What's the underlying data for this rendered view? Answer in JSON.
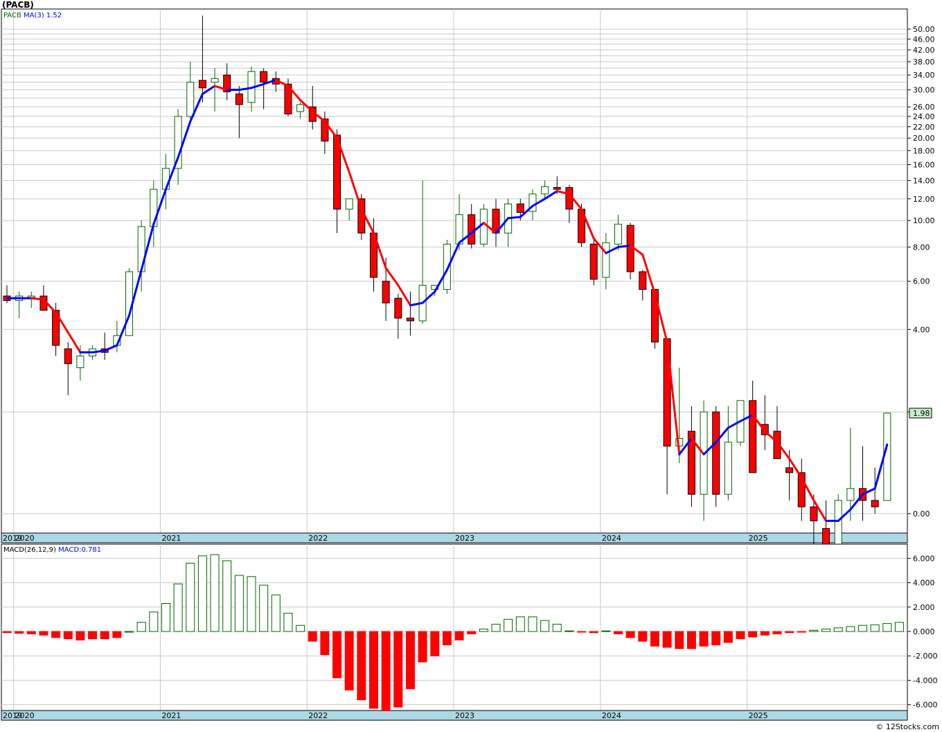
{
  "header": {
    "title": "(PACB)",
    "credit": "© 12Stocks.com"
  },
  "colors": {
    "up": "#006400",
    "down": "#ff0000",
    "ma_up": "#0000ff",
    "ma_down": "#ff0000",
    "grid": "#c8c8c8",
    "axisband": "#add8e6",
    "last_price_bg": "#c8f0c8"
  },
  "chart_data": [
    {
      "type": "candlestick",
      "scale": "log",
      "title": "(PACB)",
      "legend": {
        "symbol": "PACB",
        "ma_label": "MA(3)",
        "ma_value": "1.52"
      },
      "last_price": "1.98",
      "y_ticks": [
        "50.00",
        "46.00",
        "42.00",
        "38.00",
        "34.00",
        "30.00",
        "26.00",
        "24.00",
        "22.00",
        "20.00",
        "18.00",
        "16.00",
        "14.00",
        "12.00",
        "10.00",
        "8.00",
        "6.00",
        "4.00",
        "2.00",
        "0.00"
      ],
      "year_labels": [
        "2019",
        "2020",
        "2021",
        "2022",
        "2023",
        "2024",
        "2025"
      ],
      "x_start": "2019-12",
      "candles": [
        [
          5.3,
          5.8,
          5.0,
          5.1
        ],
        [
          5.1,
          5.5,
          4.4,
          5.3
        ],
        [
          5.3,
          5.5,
          4.8,
          5.3
        ],
        [
          5.3,
          5.8,
          4.8,
          4.7
        ],
        [
          4.7,
          5.0,
          3.2,
          3.5
        ],
        [
          3.4,
          3.6,
          2.3,
          3.0
        ],
        [
          2.9,
          3.5,
          2.6,
          3.2
        ],
        [
          3.2,
          3.5,
          3.1,
          3.4
        ],
        [
          3.4,
          3.9,
          3.1,
          3.3
        ],
        [
          3.5,
          4.3,
          3.3,
          3.8
        ],
        [
          3.8,
          6.7,
          3.8,
          6.5
        ],
        [
          6.5,
          10.0,
          5.5,
          9.5
        ],
        [
          9.5,
          14.0,
          8.0,
          13.0
        ],
        [
          13.0,
          17.5,
          11.0,
          15.5
        ],
        [
          15.5,
          25.5,
          13.5,
          24.0
        ],
        [
          24.0,
          38.0,
          23.5,
          32.0
        ],
        [
          32.5,
          56.0,
          27.0,
          30.5
        ],
        [
          32.0,
          36.0,
          25.0,
          33.0
        ],
        [
          34.0,
          37.5,
          27.5,
          29.5
        ],
        [
          29.0,
          31.0,
          20.0,
          26.5
        ],
        [
          27.0,
          36.5,
          25.0,
          35.0
        ],
        [
          35.0,
          36.0,
          25.5,
          32.0
        ],
        [
          33.0,
          35.0,
          29.5,
          31.5
        ],
        [
          31.5,
          33.0,
          24.0,
          24.5
        ],
        [
          25.0,
          27.0,
          23.5,
          26.5
        ],
        [
          26.0,
          31.0,
          21.5,
          23.0
        ],
        [
          23.5,
          25.0,
          17.5,
          19.5
        ],
        [
          20.5,
          21.5,
          9.0,
          11.0
        ],
        [
          11.0,
          12.0,
          10.0,
          12.0
        ],
        [
          12.0,
          12.5,
          8.5,
          9.0
        ],
        [
          9.0,
          10.2,
          5.5,
          6.2
        ],
        [
          6.0,
          7.3,
          4.3,
          5.0
        ],
        [
          5.2,
          5.4,
          3.7,
          4.4
        ],
        [
          4.4,
          5.5,
          3.8,
          4.3
        ],
        [
          4.3,
          14.0,
          4.2,
          5.8
        ],
        [
          5.6,
          5.8,
          5.3,
          5.8
        ],
        [
          5.6,
          8.5,
          5.4,
          8.2
        ],
        [
          8.2,
          12.5,
          7.8,
          10.5
        ],
        [
          10.5,
          11.5,
          7.9,
          8.2
        ],
        [
          8.2,
          11.5,
          8.0,
          11.0
        ],
        [
          11.0,
          12.0,
          8.0,
          9.0
        ],
        [
          9.0,
          12.0,
          8.0,
          11.5
        ],
        [
          11.5,
          12.0,
          10.0,
          10.7
        ],
        [
          10.8,
          13.0,
          10.0,
          12.5
        ],
        [
          12.5,
          14.0,
          12.0,
          13.3
        ],
        [
          13.2,
          14.5,
          12.5,
          13.0
        ],
        [
          13.2,
          13.5,
          9.8,
          11.0
        ],
        [
          11.0,
          11.5,
          8.0,
          8.3
        ],
        [
          8.2,
          8.5,
          5.8,
          6.1
        ],
        [
          6.2,
          9.0,
          5.6,
          8.3
        ],
        [
          8.2,
          10.5,
          7.8,
          9.7
        ],
        [
          9.6,
          9.8,
          6.1,
          6.5
        ],
        [
          6.5,
          6.6,
          5.1,
          5.6
        ],
        [
          5.6,
          5.5,
          3.4,
          3.6
        ],
        [
          3.7,
          3.7,
          1.0,
          1.5
        ],
        [
          1.5,
          2.9,
          1.3,
          1.6
        ],
        [
          1.7,
          2.1,
          0.9,
          1.0
        ],
        [
          1.0,
          2.2,
          0.8,
          2.0
        ],
        [
          2.0,
          2.1,
          0.9,
          1.0
        ],
        [
          1.0,
          2.1,
          0.95,
          1.55
        ],
        [
          1.55,
          2.2,
          1.5,
          2.2
        ],
        [
          2.2,
          2.6,
          1.2,
          1.2
        ],
        [
          1.8,
          2.3,
          1.45,
          1.65
        ],
        [
          1.7,
          2.1,
          1.4,
          1.35
        ],
        [
          1.25,
          1.45,
          0.95,
          1.2
        ],
        [
          1.2,
          1.35,
          0.8,
          0.9
        ],
        [
          0.9,
          1.0,
          0.6,
          0.8
        ],
        [
          0.75,
          0.95,
          0.55,
          0.55
        ],
        [
          0.6,
          1.0,
          0.55,
          0.95
        ],
        [
          0.95,
          1.75,
          0.8,
          1.05
        ],
        [
          1.05,
          1.5,
          0.8,
          0.95
        ],
        [
          0.95,
          1.25,
          0.85,
          0.9
        ],
        [
          0.95,
          1.98,
          0.95,
          1.98
        ]
      ],
      "ma": [
        5.2,
        5.2,
        5.2,
        5.15,
        4.6,
        3.9,
        3.3,
        3.3,
        3.35,
        3.5,
        4.5,
        6.6,
        9.7,
        13.0,
        17.0,
        23.0,
        29.0,
        31.0,
        30.0,
        30.0,
        30.5,
        31.5,
        32.6,
        31.0,
        27.5,
        25.0,
        23.0,
        20.0,
        15.0,
        11.0,
        9.0,
        6.7,
        5.8,
        4.9,
        5.0,
        5.5,
        6.6,
        8.3,
        9.0,
        9.8,
        9.0,
        10.2,
        10.3,
        11.3,
        12.0,
        12.8,
        12.5,
        11.0,
        8.6,
        7.6,
        8.0,
        8.1,
        7.5,
        5.4,
        3.6,
        1.4,
        1.6,
        1.4,
        1.55,
        1.75,
        1.85,
        1.95,
        1.7,
        1.55,
        1.35,
        1.15,
        0.95,
        0.8,
        0.8,
        0.88,
        1.0,
        1.05,
        1.52
      ]
    },
    {
      "type": "bar",
      "title": "MACD(26,12,9)",
      "legend": {
        "label": "MACD(26,12,9)",
        "value_label": "MACD:0.781"
      },
      "y_ticks": [
        "6.000",
        "4.000",
        "2.000",
        "0.000",
        "-2.000",
        "-4.000",
        "-6.000"
      ],
      "ylim": [
        -6.6,
        6.4
      ],
      "year_labels": [
        "2019",
        "2020",
        "2021",
        "2022",
        "2023",
        "2024",
        "2025"
      ],
      "values": [
        -0.1,
        -0.15,
        -0.2,
        -0.3,
        -0.5,
        -0.6,
        -0.7,
        -0.6,
        -0.6,
        -0.5,
        0.0,
        0.75,
        1.6,
        2.3,
        3.9,
        5.6,
        6.2,
        6.3,
        5.8,
        4.6,
        4.5,
        3.8,
        3.0,
        1.5,
        0.5,
        -0.8,
        -1.9,
        -3.8,
        -4.8,
        -5.6,
        -6.3,
        -6.5,
        -6.2,
        -4.7,
        -2.5,
        -2.0,
        -1.1,
        -0.7,
        -0.2,
        0.2,
        0.6,
        1.0,
        1.2,
        1.2,
        0.9,
        0.6,
        0.05,
        -0.05,
        -0.1,
        0.05,
        -0.2,
        -0.5,
        -0.8,
        -1.2,
        -1.3,
        -1.4,
        -1.4,
        -1.2,
        -1.1,
        -0.9,
        -0.6,
        -0.45,
        -0.3,
        -0.2,
        -0.1,
        -0.05,
        0.1,
        0.2,
        0.3,
        0.4,
        0.5,
        0.55,
        0.65,
        0.75
      ]
    }
  ]
}
